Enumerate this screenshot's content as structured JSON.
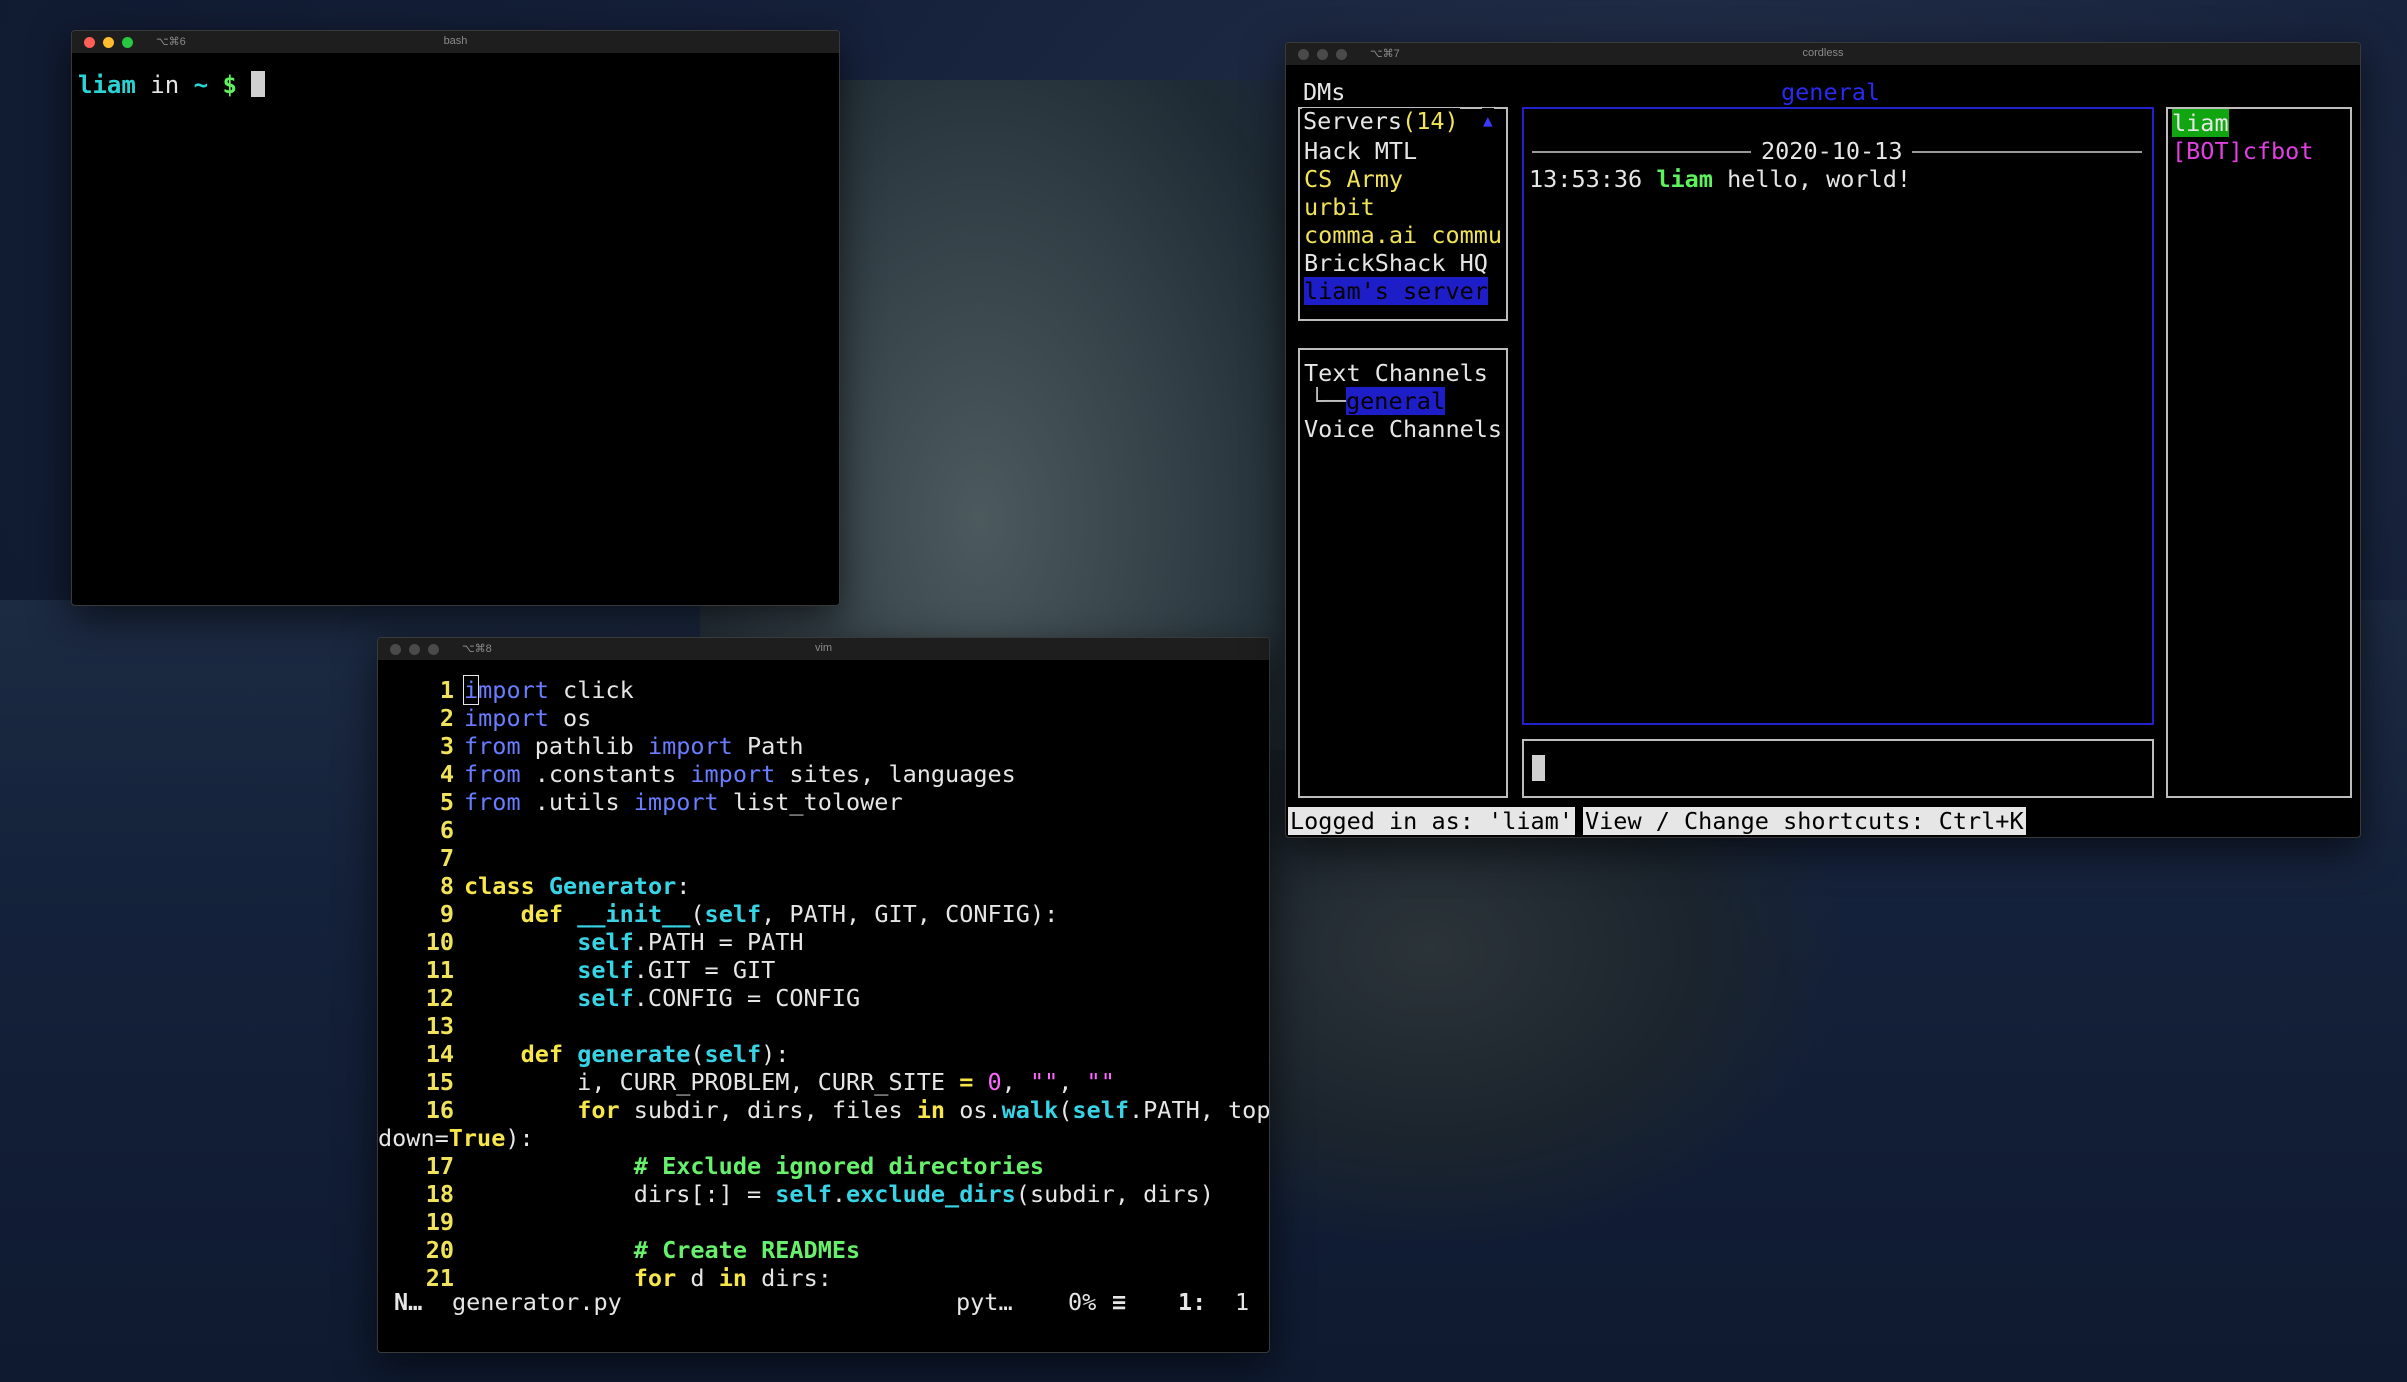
{
  "desktop": {
    "wallpaper": "coastal mountains at dusk"
  },
  "bash_window": {
    "shortcut": "⌥⌘6",
    "title": "bash",
    "prompt_user": "liam",
    "prompt_in": " in ",
    "prompt_dir": "~",
    "prompt_symbol": " $ "
  },
  "vim_window": {
    "shortcut": "⌥⌘8",
    "title": "vim",
    "status": {
      "mode": "N…",
      "filename": "generator.py",
      "filetype": "pyt…",
      "percent": "0%",
      "menu_icon": "≡",
      "line": "1:",
      "col": "1"
    }
  },
  "cordless_window": {
    "shortcut": "⌥⌘7",
    "title": "cordless",
    "dms_label": "DMs",
    "servers_label": "Servers",
    "servers_count": "(14)",
    "scroll_arrow": "▲",
    "servers": [
      "Hack MTL",
      "CS Army",
      "urbit",
      "comma.ai commu",
      "BrickShack HQ",
      "liam's server"
    ],
    "text_channels_label": "Text Channels",
    "channel_tree_branch": "└──",
    "active_channel": "general",
    "voice_channels_label": "Voice Channels",
    "chat_title": "general",
    "date_separator": "2020-10-13",
    "message": {
      "time": "13:53:36",
      "author": "liam",
      "text": "hello, world!"
    },
    "users": [
      "liam",
      "[BOT]cfbot"
    ],
    "logged_in": "Logged in as: 'liam'",
    "shortcuts_hint": "View / Change shortcuts: Ctrl+K"
  },
  "colors": {
    "close": "#ff5f57",
    "minimize": "#febc2e",
    "maximize": "#28c840",
    "inactive_dot": "#4a4a4a",
    "bg": "#000000"
  }
}
